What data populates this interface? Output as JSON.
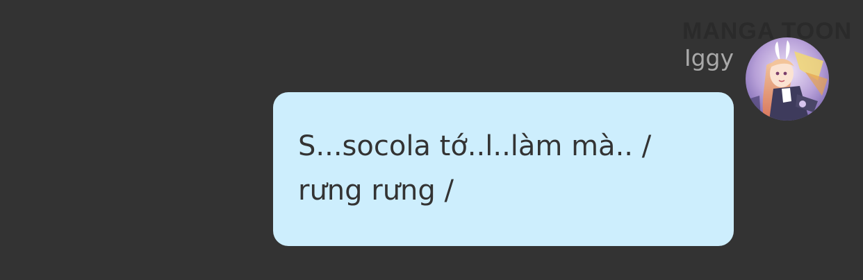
{
  "watermark": {
    "text": "MANGA TOON"
  },
  "message": {
    "sender_name": "Iggy",
    "avatar_icon": "anime-character-avatar",
    "text": "S...socola tớ..l..làm mà.. /\nrưng rưng /",
    "bubble_color": "#cdeefd"
  },
  "background_color": "#333333"
}
